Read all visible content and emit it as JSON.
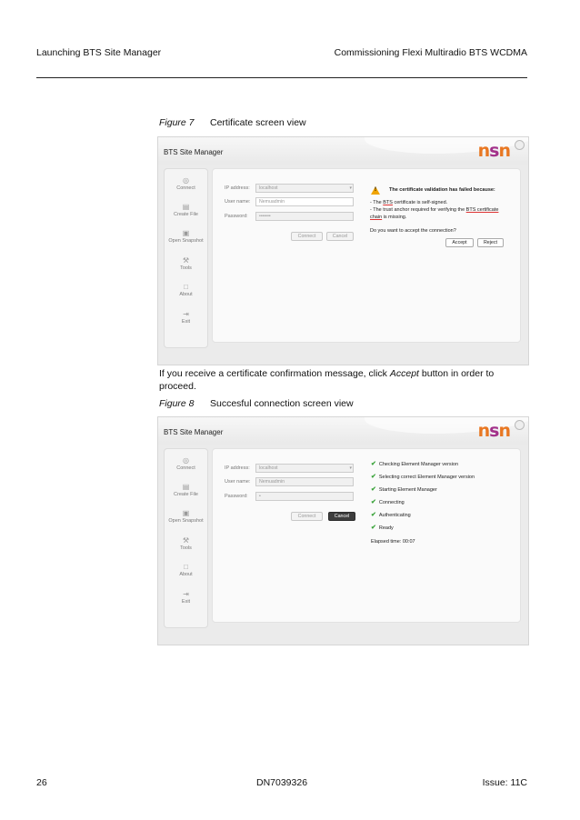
{
  "header": {
    "left": "Launching BTS Site Manager",
    "right": "Commissioning Flexi Multiradio BTS WCDMA"
  },
  "figure7": {
    "number": "Figure 7",
    "title": "Certificate screen view"
  },
  "paragraph": {
    "before": "If you receive a certificate confirmation message, click ",
    "emphasis": "Accept",
    "after": " button in order to proceed."
  },
  "figure8": {
    "number": "Figure 8",
    "title": "Succesful connection screen view"
  },
  "app": {
    "title": "BTS Site Manager",
    "logo_n": "n",
    "logo_s": "s",
    "logo_n2": "n",
    "brand_color": "#e87722",
    "accent_color": "#a3318a",
    "sidebar": [
      {
        "icon": "connect-icon",
        "label": "Connect"
      },
      {
        "icon": "create-file-icon",
        "label": "Create File"
      },
      {
        "icon": "open-snapshot-icon",
        "label": "Open Snapshot"
      },
      {
        "icon": "tools-icon",
        "label": "Tools"
      },
      {
        "icon": "about-icon",
        "label": "About"
      },
      {
        "icon": "exit-icon",
        "label": "Exit"
      }
    ],
    "form": {
      "ip_label": "IP address:",
      "ip_value": "localhost",
      "user_label": "User name:",
      "user_value": "Nemuadmin",
      "password_label": "Password:"
    },
    "connect_label": "Connect",
    "cancel_label": "Cancel"
  },
  "shot1": {
    "password_value": "•••••••",
    "warning_title": "The certificate validation has failed because:",
    "line1_prefix": "- The ",
    "line1_link": "BTS",
    "line1_suffix": " certificate is self-signed.",
    "line2_prefix": "- The trust anchor required for verifying the ",
    "line2_link": "BTS certificate",
    "line3_link": "chain",
    "line3_suffix": " is missing.",
    "question": "Do you want to accept the connection?",
    "accept_label": "Accept",
    "reject_label": "Reject"
  },
  "shot2": {
    "password_value": "•",
    "steps": [
      "Checking Element Manager version",
      "Selecting correct Element Manager version",
      "Starting Element Manager",
      "Connecting",
      "Authenticating",
      "Ready"
    ],
    "elapsed": "Elapsed time: 00:07",
    "check_color": "#3ba33b"
  },
  "footer": {
    "page": "26",
    "doc": "DN7039326",
    "issue": "Issue: 11C"
  }
}
